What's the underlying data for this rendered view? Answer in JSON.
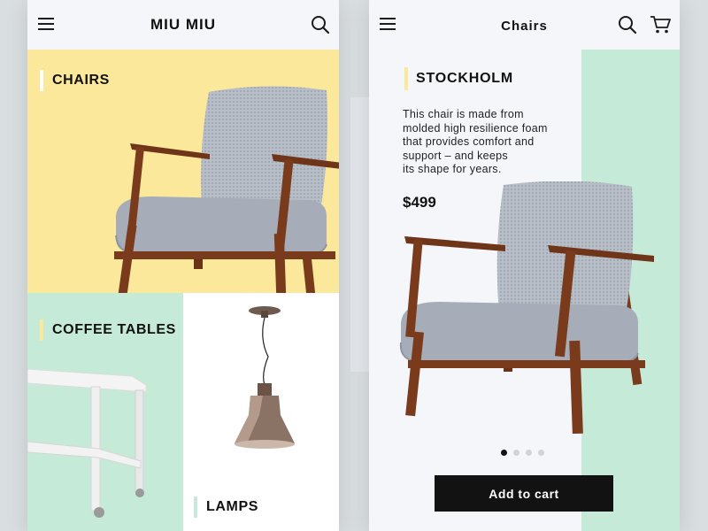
{
  "left_screen": {
    "brand": "MIU MIU",
    "menu_icon": "hamburger-menu-icon",
    "search_icon": "search-icon",
    "categories": [
      {
        "label": "CHAIRS",
        "color": "#fbe89a"
      },
      {
        "label": "COFFEE TABLES",
        "color": "#c6ead8"
      },
      {
        "label": "LAMPS",
        "color": "#ffffff"
      }
    ]
  },
  "right_screen": {
    "title": "Chairs",
    "menu_icon": "hamburger-menu-icon",
    "search_icon": "search-icon",
    "cart_icon": "shopping-cart-icon",
    "product": {
      "name": "STOCKHOLM",
      "description_lines": [
        "This chair is made from",
        "molded high resilience foam",
        "that provides comfort and",
        "support – and keeps",
        "its shape for years."
      ],
      "price": "$499"
    },
    "carousel": {
      "count": 4,
      "active": 1
    },
    "cta": "Add to cart"
  },
  "colors": {
    "accent_yellow": "#fbe89a",
    "accent_mint": "#c6ead8",
    "dark": "#121212"
  }
}
